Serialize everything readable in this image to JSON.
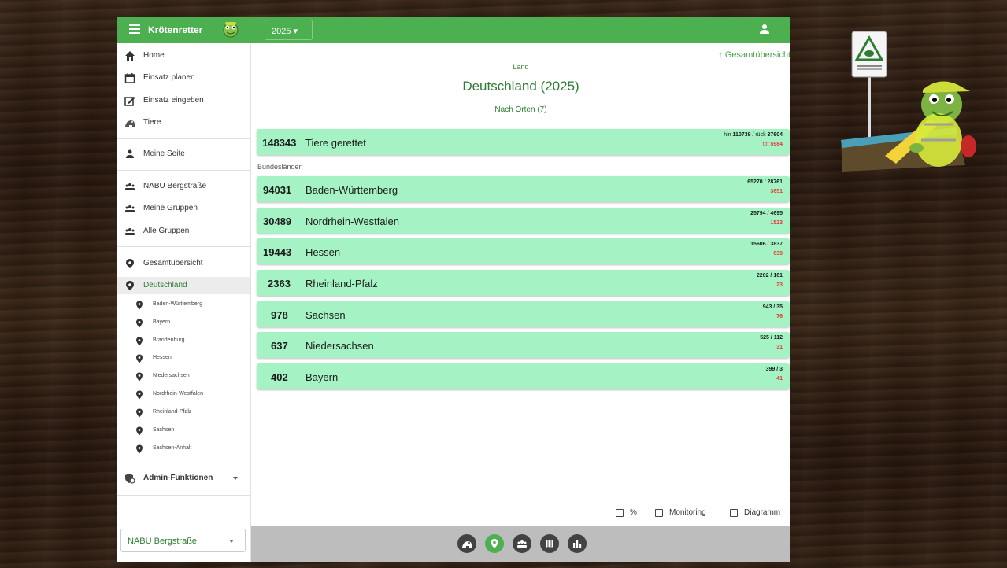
{
  "header": {
    "brand": "Krötenretter",
    "year": "2025 ▾"
  },
  "sidebar": {
    "main_items": [
      {
        "label": "Home"
      },
      {
        "label": "Einsatz planen"
      },
      {
        "label": "Einsatz eingeben"
      },
      {
        "label": "Tiere"
      }
    ],
    "my_page": "Meine Seite",
    "groups": [
      {
        "label": "NABU Bergstraße"
      },
      {
        "label": "Meine Gruppen"
      },
      {
        "label": "Alle Gruppen"
      }
    ],
    "overview": "Gesamtübersicht",
    "current": "Deutschland",
    "states": [
      "Baden-Württemberg",
      "Bayern",
      "Brandenburg",
      "Hessen",
      "Niedersachsen",
      "Nordrhein-Westfalen",
      "Rheinland-Pfalz",
      "Sachsen",
      "Sachsen-Anhalt"
    ],
    "admin": "Admin-Funktionen",
    "group_select": "NABU Bergstraße"
  },
  "main": {
    "back_link": "↑ Gesamtübersicht",
    "land_label": "Land",
    "title": "Deutschland (2025)",
    "subtitle": "Nach Orten (7)",
    "total": {
      "count": "148343",
      "label": "Tiere gerettet",
      "hin_prefix": "hin",
      "hin": "110739",
      "rueck_prefix": "/ rück",
      "rueck": "37604",
      "tot_prefix": "tot",
      "tot": "5984"
    },
    "section_label": "Bundesländer:",
    "cards": [
      {
        "count": "94031",
        "name": "Baden-Württemberg",
        "ratio": "65270 / 28761",
        "dead": "3651"
      },
      {
        "count": "30489",
        "name": "Nordrhein-Westfalen",
        "ratio": "25794 / 4695",
        "dead": "1523"
      },
      {
        "count": "19443",
        "name": "Hessen",
        "ratio": "15606 / 3837",
        "dead": "639"
      },
      {
        "count": "2363",
        "name": "Rheinland-Pfalz",
        "ratio": "2202 / 161",
        "dead": "23"
      },
      {
        "count": "978",
        "name": "Sachsen",
        "ratio": "943 / 35",
        "dead": "76"
      },
      {
        "count": "637",
        "name": "Niedersachsen",
        "ratio": "525 / 112",
        "dead": "31"
      },
      {
        "count": "402",
        "name": "Bayern",
        "ratio": "399 / 3",
        "dead": "41"
      }
    ],
    "options": [
      {
        "label": "%"
      },
      {
        "label": "Monitoring"
      },
      {
        "label": "Diagramm"
      }
    ]
  },
  "bottom_nav": [
    {
      "icon": "toad-icon"
    },
    {
      "icon": "location-icon"
    },
    {
      "icon": "groups-icon"
    },
    {
      "icon": "map-icon"
    },
    {
      "icon": "chart-icon"
    }
  ],
  "colors": {
    "primary": "#4caf50",
    "card": "#a5f3c5",
    "dead": "#e53935",
    "title": "#2e7d32"
  }
}
